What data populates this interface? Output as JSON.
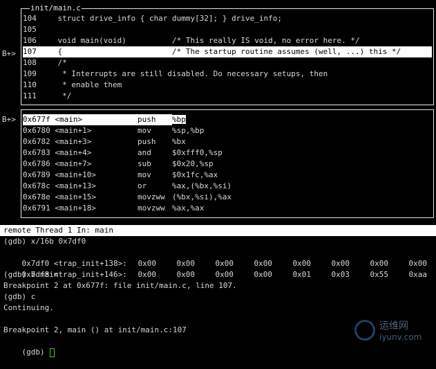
{
  "source_window": {
    "title": "init/main.c",
    "breakpoint_marker": "B+>",
    "lines": [
      {
        "num": "104",
        "code": "    struct drive_info { char dummy[32]; } drive_info;"
      },
      {
        "num": "105",
        "code": ""
      },
      {
        "num": "106",
        "code": "    void main(void)          /* This really IS void, no error here. */"
      },
      {
        "num": "107",
        "code": "    {                        /* The startup routine assumes (well, ...) this */"
      },
      {
        "num": "108",
        "code": "    /*"
      },
      {
        "num": "109",
        "code": "     * Interrupts are still disabled. Do necessary setups, then"
      },
      {
        "num": "110",
        "code": "     * enable them"
      },
      {
        "num": "111",
        "code": "     */"
      }
    ]
  },
  "asm_window": {
    "breakpoint_marker": "B+>",
    "lines": [
      {
        "addr": "0x677f <main>",
        "op": "push",
        "args": "%bp"
      },
      {
        "addr": "0x6780 <main+1>",
        "op": "mov",
        "args": "%sp,%bp"
      },
      {
        "addr": "0x6782 <main+3>",
        "op": "push",
        "args": "%bx"
      },
      {
        "addr": "0x6783 <main+4>",
        "op": "and",
        "args": "$0xfff0,%sp"
      },
      {
        "addr": "0x6786 <main+7>",
        "op": "sub",
        "args": "$0x20,%sp"
      },
      {
        "addr": "0x6789 <main+10>",
        "op": "mov",
        "args": "$0x1fc,%ax"
      },
      {
        "addr": "0x678c <main+13>",
        "op": "or",
        "args": "%ax,(%bx,%si)"
      },
      {
        "addr": "0x678e <main+15>",
        "op": "movzww",
        "args": "(%bx,%si),%ax"
      },
      {
        "addr": "0x6791 <main+18>",
        "op": "movzww",
        "args": "%ax,%ax"
      }
    ]
  },
  "status_bar": {
    "text": "remote Thread 1 In: main"
  },
  "command": {
    "line1": "(gdb) x/16b 0x7df0",
    "mem_rows": [
      {
        "label": "0x7df0 <trap_init+138>:",
        "bytes": [
          "0x00",
          "0x00",
          "0x00",
          "0x00",
          "0x00",
          "0x00",
          "0x00",
          "0x00"
        ]
      },
      {
        "label": "0x7df8 <trap_init+146>:",
        "bytes": [
          "0x00",
          "0x00",
          "0x00",
          "0x00",
          "0x01",
          "0x03",
          "0x55",
          "0xaa"
        ]
      }
    ],
    "line4": "(gdb) b main",
    "line5": "Breakpoint 2 at 0x677f: file init/main.c, line 107.",
    "line6": "(gdb) c",
    "line7": "Continuing.",
    "line8": "",
    "line9": "Breakpoint 2, main () at init/main.c:107",
    "prompt": "(gdb) "
  },
  "watermark": {
    "cn": "运维网",
    "url": "iyunv.com"
  },
  "colors": {
    "background": "#000000",
    "text": "#d8d8d8",
    "highlight": "#ffffff",
    "cursor": "#2fd12f"
  }
}
